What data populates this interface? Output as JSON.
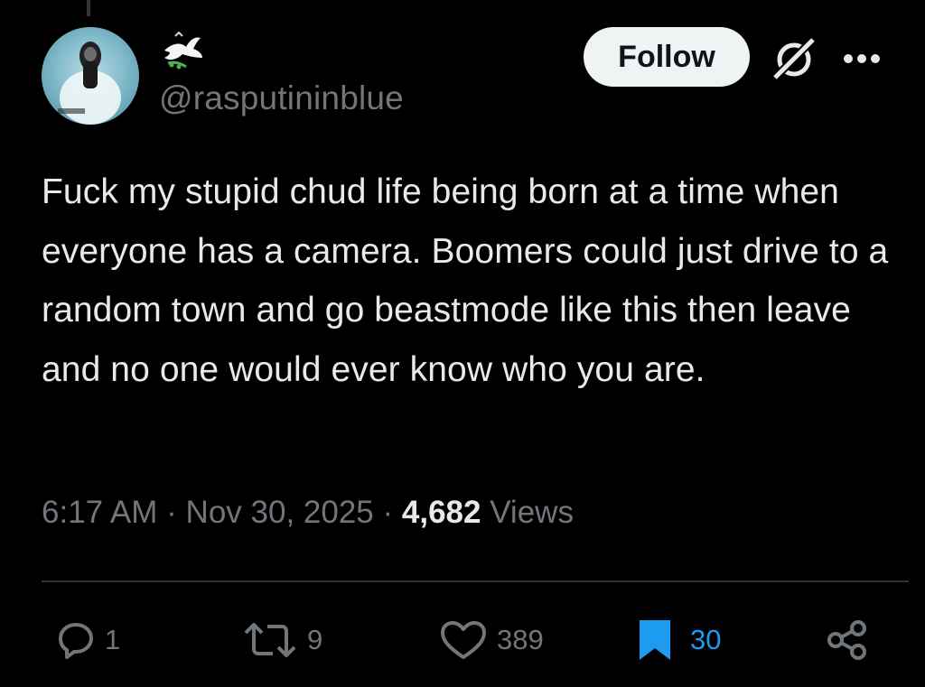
{
  "author": {
    "handle": "@rasputininblue",
    "badge_icon": "dove-icon"
  },
  "header": {
    "follow_label": "Follow",
    "grok_icon": "grok-icon",
    "more_icon": "more-icon"
  },
  "tweet": {
    "text": "Fuck my stupid chud life being born at a time when everyone has a camera. Boomers could just drive to a random town and go beastmode like this then leave and no one would ever know who you are.",
    "time": "6:17 AM",
    "date": "Nov 30, 2025",
    "views_count": "4,682",
    "views_label": "Views"
  },
  "actions": {
    "replies": "1",
    "reposts": "9",
    "likes": "389",
    "bookmarks": "30"
  },
  "colors": {
    "background": "#000000",
    "text_primary": "#e7e9ea",
    "text_secondary": "#71767b",
    "bookmark_active": "#1d9bf0",
    "follow_button_bg": "#eff3f4"
  }
}
